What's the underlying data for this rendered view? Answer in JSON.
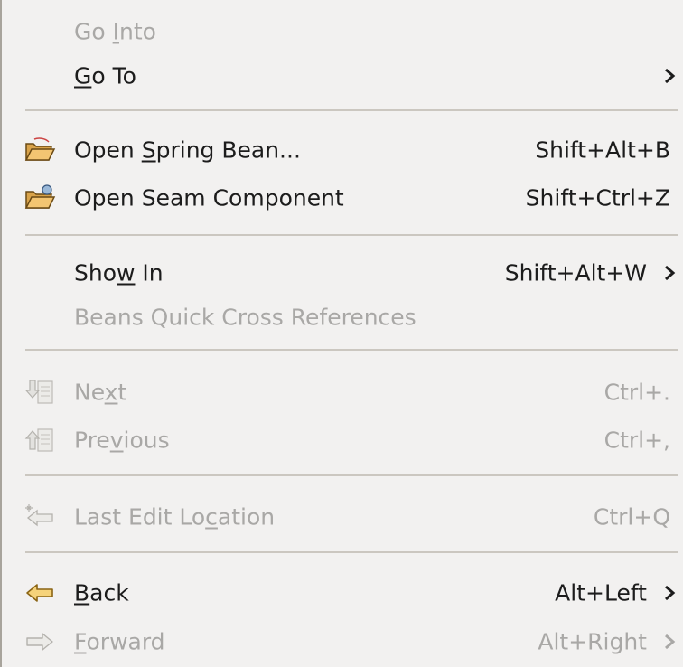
{
  "menu": {
    "go_into": {
      "pre": "Go ",
      "u": "I",
      "post": "nto"
    },
    "go_to": {
      "pre": "",
      "u": "G",
      "post": "o To"
    },
    "open_spring_bean": {
      "pre": "Open ",
      "u": "S",
      "post": "pring Bean...",
      "shortcut": "Shift+Alt+B"
    },
    "open_seam_component": {
      "label": "Open Seam Component",
      "shortcut": "Shift+Ctrl+Z"
    },
    "show_in": {
      "pre": "Sho",
      "u": "w",
      "post": " In",
      "shortcut": "Shift+Alt+W"
    },
    "beans_quick_cross_references": {
      "label": "Beans Quick Cross References"
    },
    "next": {
      "pre": "Ne",
      "u": "x",
      "post": "t",
      "shortcut": "Ctrl+."
    },
    "previous": {
      "pre": "Pre",
      "u": "v",
      "post": "ious",
      "shortcut": "Ctrl+,"
    },
    "last_edit_location": {
      "pre": "Last Edit Lo",
      "u": "c",
      "post": "ation",
      "shortcut": "Ctrl+Q"
    },
    "back": {
      "pre": "",
      "u": "B",
      "post": "ack",
      "shortcut": "Alt+Left"
    },
    "forward": {
      "pre": "",
      "u": "F",
      "post": "orward",
      "shortcut": "Alt+Right"
    }
  },
  "colors": {
    "background": "#f2f1f0",
    "text": "#1c1c1c",
    "disabled_text": "#a9a8a6",
    "separator": "#cbc7c0",
    "folder_yellow": "#f3c572",
    "arrow_yellow": "#f6d37a"
  },
  "icons": {
    "open_spring_bean": "open-folder-icon",
    "open_seam_component": "open-folder-seam-icon",
    "next": "next-annotation-icon",
    "previous": "previous-annotation-icon",
    "last_edit_location": "last-edit-location-icon",
    "back": "back-arrow-icon",
    "forward": "forward-arrow-icon",
    "submenu": "chevron-right-icon"
  }
}
